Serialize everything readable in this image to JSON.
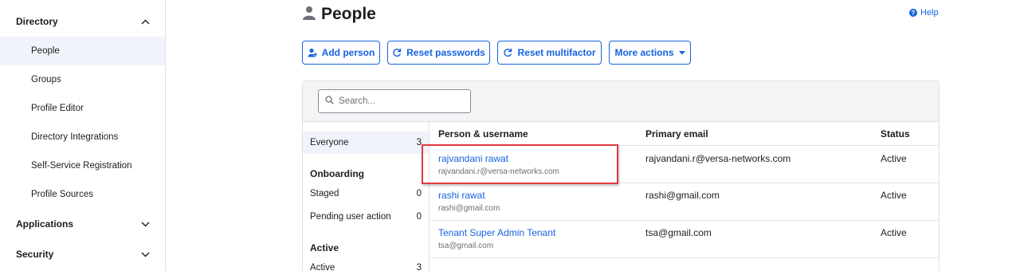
{
  "sidebar": {
    "sections": [
      {
        "label": "Directory",
        "icon": "chevron-up-icon"
      },
      {
        "label": "Applications",
        "icon": "chevron-down-icon"
      },
      {
        "label": "Security",
        "icon": "chevron-down-icon"
      }
    ],
    "directory_items": [
      {
        "label": "People",
        "active": true
      },
      {
        "label": "Groups"
      },
      {
        "label": "Profile Editor"
      },
      {
        "label": "Directory Integrations"
      },
      {
        "label": "Self-Service Registration"
      },
      {
        "label": "Profile Sources"
      }
    ]
  },
  "header": {
    "title": "People",
    "title_icon": "person-icon",
    "help_label": "Help"
  },
  "actions": {
    "add_person": "Add person",
    "reset_passwords": "Reset passwords",
    "reset_multifactor": "Reset multifactor",
    "more_actions": "More actions"
  },
  "search": {
    "placeholder": "Search..."
  },
  "filters": {
    "everyone": {
      "label": "Everyone",
      "count": "3"
    },
    "onboarding_heading": "Onboarding",
    "staged": {
      "label": "Staged",
      "count": "0"
    },
    "pending": {
      "label": "Pending user action",
      "count": "0"
    },
    "active_heading": "Active",
    "active": {
      "label": "Active",
      "count": "3"
    }
  },
  "table": {
    "columns": [
      "Person & username",
      "Primary email",
      "Status"
    ],
    "rows": [
      {
        "name": "rajvandani rawat",
        "username": "rajvandani.r@versa-networks.com",
        "email": "rajvandani.r@versa-networks.com",
        "status": "Active"
      },
      {
        "name": "rashi rawat",
        "username": "rashi@gmail.com",
        "email": "rashi@gmail.com",
        "status": "Active"
      },
      {
        "name": "Tenant Super Admin Tenant",
        "username": "tsa@gmail.com",
        "email": "tsa@gmail.com",
        "status": "Active"
      }
    ]
  },
  "colors": {
    "accent": "#1662dd",
    "highlight": "#e0393e",
    "selected_bg": "#f0f3fa"
  }
}
